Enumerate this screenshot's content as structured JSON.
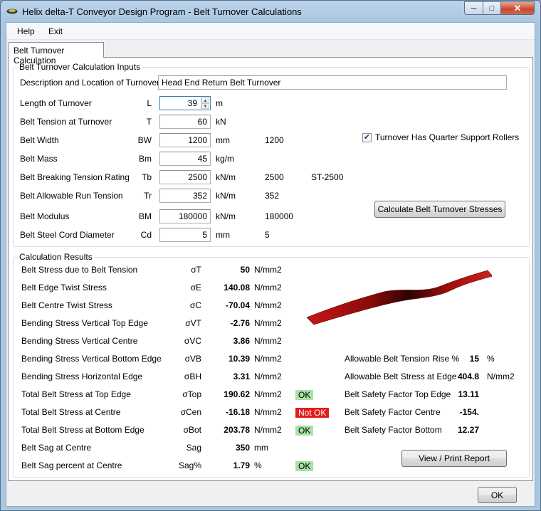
{
  "window": {
    "title": "Helix delta-T Conveyor Design Program - Belt Turnover Calculations"
  },
  "menu": {
    "help": "Help",
    "exit": "Exit"
  },
  "tab": {
    "label": "Belt Turnover Calculation"
  },
  "inputs": {
    "group_title": "Belt Turnover Calculation Inputs",
    "description": {
      "label": "Description and Location of Turnover",
      "value": "Head End Return Belt Turnover"
    },
    "rows": [
      {
        "label": "Length of Turnover",
        "symbol": "L",
        "value": "39",
        "unit": "m",
        "extra": "",
        "grade": ""
      },
      {
        "label": "Belt Tension at Turnover",
        "symbol": "T",
        "value": "60",
        "unit": "kN",
        "extra": "",
        "grade": ""
      },
      {
        "label": "Belt Width",
        "symbol": "BW",
        "value": "1200",
        "unit": "mm",
        "extra": "1200",
        "grade": ""
      },
      {
        "label": "Belt Mass",
        "symbol": "Bm",
        "value": "45",
        "unit": "kg/m",
        "extra": "",
        "grade": ""
      },
      {
        "label": "Belt Breaking Tension Rating",
        "symbol": "Tb",
        "value": "2500",
        "unit": "kN/m",
        "extra": "2500",
        "grade": "ST-2500"
      },
      {
        "label": "Belt Allowable Run Tension",
        "symbol": "Tr",
        "value": "352",
        "unit": "kN/m",
        "extra": "352",
        "grade": ""
      },
      {
        "label": "Belt Modulus",
        "symbol": "BM",
        "value": "180000",
        "unit": "kN/m",
        "extra": "180000",
        "grade": ""
      },
      {
        "label": "Belt Steel Cord Diameter",
        "symbol": "Cd",
        "value": "5",
        "unit": "mm",
        "extra": "5",
        "grade": ""
      }
    ],
    "quarter_rollers": {
      "label": "Turnover Has Quarter Support Rollers",
      "checked": true
    },
    "calculate_button": "Calculate Belt Turnover Stresses"
  },
  "results": {
    "group_title": "Calculation Results",
    "rows": [
      {
        "label": "Belt Stress due to Belt Tension",
        "symbol": "σT",
        "value": "50",
        "unit": "N/mm2",
        "status": ""
      },
      {
        "label": "Belt Edge Twist Stress",
        "symbol": "σE",
        "value": "140.08",
        "unit": "N/mm2",
        "status": ""
      },
      {
        "label": "Belt Centre Twist Stress",
        "symbol": "σC",
        "value": "-70.04",
        "unit": "N/mm2",
        "status": ""
      },
      {
        "label": "Bending Stress Vertical Top Edge",
        "symbol": "σVT",
        "value": "-2.76",
        "unit": "N/mm2",
        "status": ""
      },
      {
        "label": "Bending Stress Vertical Centre",
        "symbol": "σVC",
        "value": "3.86",
        "unit": "N/mm2",
        "status": ""
      },
      {
        "label": "Bending Stress Vertical Bottom Edge",
        "symbol": "σVB",
        "value": "10.39",
        "unit": "N/mm2",
        "status": ""
      },
      {
        "label": "Bending Stress Horizontal Edge",
        "symbol": "σBH",
        "value": "3.31",
        "unit": "N/mm2",
        "status": ""
      },
      {
        "label": "Total Belt Stress at Top Edge",
        "symbol": "σTop",
        "value": "190.62",
        "unit": "N/mm2",
        "status": "OK"
      },
      {
        "label": "Total Belt Stress at Centre",
        "symbol": "σCen",
        "value": "-16.18",
        "unit": "N/mm2",
        "status": "Not OK"
      },
      {
        "label": "Total Belt Stress at Bottom Edge",
        "symbol": "σBot",
        "value": "203.78",
        "unit": "N/mm2",
        "status": "OK"
      },
      {
        "label": "Belt Sag at Centre",
        "symbol": "Sag",
        "value": "350",
        "unit": "mm",
        "status": ""
      },
      {
        "label": "Belt Sag percent at Centre",
        "symbol": "Sag%",
        "value": "1.79",
        "unit": "%",
        "status": "OK"
      }
    ],
    "right": [
      {
        "label": "Allowable Belt Tension Rise %",
        "value": "15",
        "unit": "%"
      },
      {
        "label": "Allowable Belt Stress at Edge",
        "value": "404.8",
        "unit": "N/mm2"
      },
      {
        "label": "Belt Safety Factor Top Edge",
        "value": "13.11",
        "unit": ""
      },
      {
        "label": "Belt Safety Factor Centre",
        "value": "-154.",
        "unit": ""
      },
      {
        "label": "Belt Safety Factor Bottom",
        "value": "12.27",
        "unit": ""
      }
    ],
    "report_button": "View / Print Report"
  },
  "ok_button": "OK",
  "colors": {
    "belt": "#b01010",
    "ok": "#a8e2a8",
    "not_ok": "#e51c1c"
  }
}
